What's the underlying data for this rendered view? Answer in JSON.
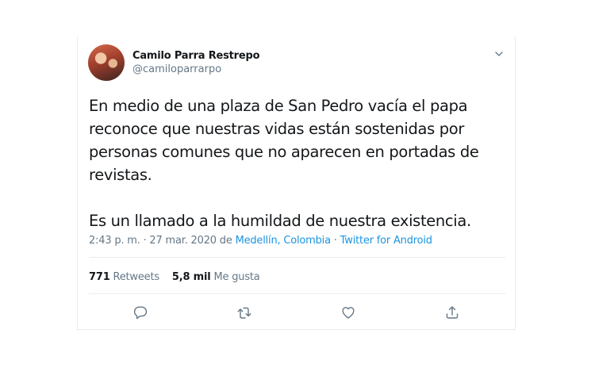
{
  "tweet": {
    "author": {
      "name": "Camilo Parra Restrepo",
      "handle": "@camiloparrarpo"
    },
    "text_paragraphs": [
      "En medio de una plaza de San Pedro vacía el papa reconoce que nuestras vidas están sostenidas por personas comunes que no aparecen en portadas de revistas.",
      "Es un llamado a la humildad de nuestra existencia."
    ],
    "meta": {
      "timestamp": "2:43 p. m. · 27 mar. 2020 de ",
      "location": "Medellín, Colombia",
      "separator": " · ",
      "source": "Twitter for Android"
    },
    "stats": {
      "retweets_count": "771",
      "retweets_label": " Retweets",
      "likes_count": "5,8 mil",
      "likes_label": " Me gusta"
    },
    "icons": {
      "menu": "chevron-down-icon",
      "reply": "reply-icon",
      "retweet": "retweet-icon",
      "like": "heart-icon",
      "share": "share-icon"
    },
    "colors": {
      "text": "#14171a",
      "muted": "#657786",
      "link": "#1b95e0",
      "border": "#e6ecf0"
    }
  }
}
